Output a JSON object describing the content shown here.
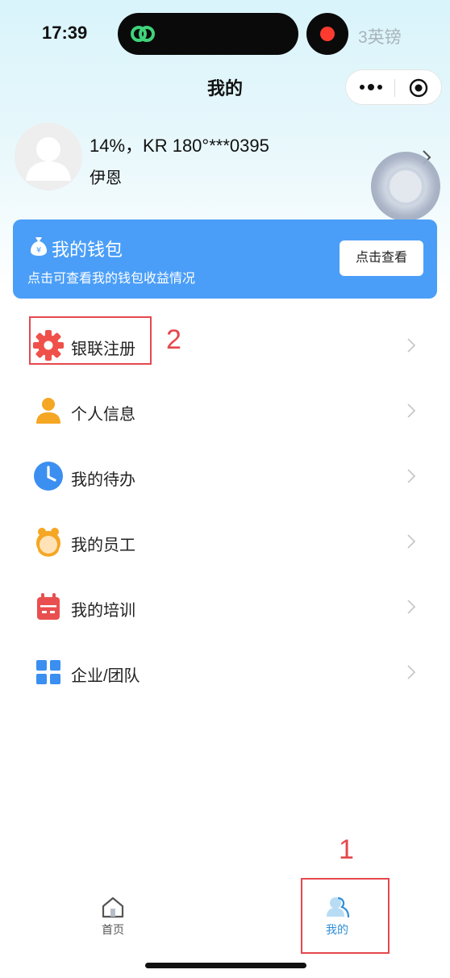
{
  "status_bar": {
    "time": "17:39",
    "carrier": "3英镑",
    "recording_color": "#ff3b30"
  },
  "header": {
    "title": "我的",
    "more_icon": "more-dots-icon",
    "close_icon": "target-circle-icon"
  },
  "profile": {
    "name": "14%，KR 180°***0395",
    "subtitle": "伊恩"
  },
  "wallet": {
    "title": "我的钱包",
    "description": "点击可查看我的钱包收益情况",
    "button_label": "点击查看",
    "color": "#4a9ef8"
  },
  "menu": {
    "items": [
      {
        "label": "银联注册",
        "icon": "gear-icon",
        "color": "#f0504a"
      },
      {
        "label": "个人信息",
        "icon": "person-icon",
        "color": "#f5a623"
      },
      {
        "label": "我的待办",
        "icon": "clock-icon",
        "color": "#3b8ff0"
      },
      {
        "label": "我的员工",
        "icon": "staff-avatar-icon",
        "color": "#f5a623"
      },
      {
        "label": "我的培训",
        "icon": "calendar-icon",
        "color": "#e94f4f"
      },
      {
        "label": "企业/团队",
        "icon": "grid-icon",
        "color": "#3b8ff0"
      }
    ]
  },
  "annotations": {
    "mark_1": "1",
    "mark_2": "2",
    "color": "#e5484d"
  },
  "tab_bar": {
    "tabs": [
      {
        "label": "首页",
        "icon": "home-icon"
      },
      {
        "label": "我的",
        "icon": "user-icon",
        "active": true
      }
    ],
    "active_color": "#2f8fd8"
  }
}
